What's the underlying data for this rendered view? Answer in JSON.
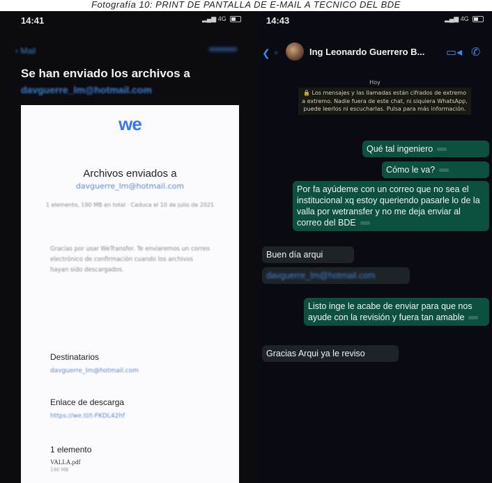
{
  "caption": "Fotografía 10: PRINT DE PANTALLA DE E-MAIL A TECNICO DEL BDE",
  "left_phone": {
    "status_time": "14:41",
    "network": "4G",
    "back_label": "Mail",
    "sent_title": "Se han enviado los archivos a",
    "sent_email": "davguerre_lm@hotmail.com",
    "card": {
      "logo": "we",
      "heading": "Archivos enviados a",
      "recipient": "davguerre_lm@hotmail.com",
      "fine_print": "1 elemento, 190 MB en total · Caduca el 10 de julio de 2021",
      "paragraph": "Gracias por usar WeTransfer. Te enviaremos un correo electrónico de confirmación cuando los archivos hayan sido descargados.",
      "recipients_label": "Destinatarios",
      "recipients_value": "davguerre_lm@hotmail.com",
      "download_label": "Enlace de descarga",
      "download_value": "https://we.tl/t-FKDL42hf",
      "items_label": "1 elemento",
      "file_name": "VALLA.pdf",
      "file_size": "190 MB"
    }
  },
  "right_phone": {
    "status_time": "14:43",
    "network": "4G",
    "contact_name": "Ing Leonardo Guerrero B...",
    "day_label": "Hoy",
    "encryption_notice": "Los mensajes y las llamadas están cifrados de extremo a extremo. Nadie fuera de este chat, ni siquiera WhatsApp, puede leerlos ni escucharlas. Pulsa para más información.",
    "messages": [
      {
        "dir": "out",
        "text": "Qué tal ingeniero"
      },
      {
        "dir": "out",
        "text": "Cómo le va?"
      },
      {
        "dir": "out",
        "text": "Por fa ayúdeme con un correo que no sea el institucional xq estoy queriendo pasarle lo de la valla por wetransfer y no me deja enviar al correo del BDE"
      },
      {
        "dir": "in",
        "text": "Buen día arqui"
      },
      {
        "dir": "in",
        "text": "davguerre_lm@hotmail.com"
      },
      {
        "dir": "out",
        "text": "Listo inge le acabe de enviar para que nos ayude con la revisión y fuera tan amable"
      },
      {
        "dir": "in",
        "text": "Gracias Arqui ya le reviso"
      }
    ]
  }
}
